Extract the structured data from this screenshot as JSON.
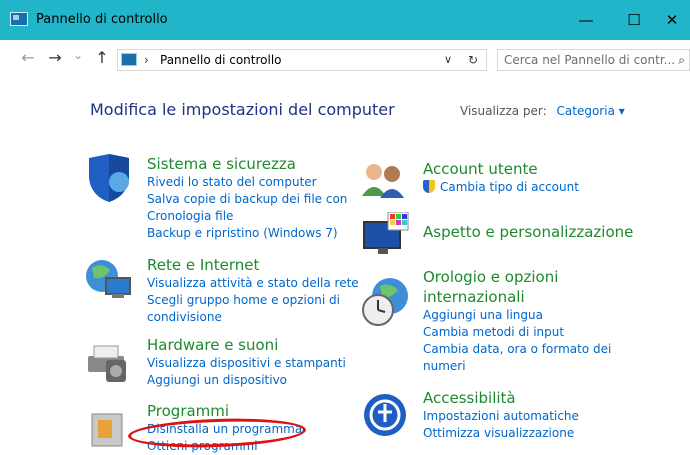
{
  "window": {
    "title": "Pannello di controllo",
    "min": "—",
    "max": "☐",
    "close": "✕"
  },
  "nav": {
    "back": "←",
    "forward": "→",
    "recent": "⌄",
    "up": "↑"
  },
  "address": {
    "separator": "›",
    "path": "Pannello di controllo",
    "dropdown": "∨",
    "refresh": "↻"
  },
  "search": {
    "placeholder": "Cerca nel Pannello di contr..."
  },
  "main": {
    "heading": "Modifica le impostazioni del computer",
    "view_by_label": "Visualizza per:",
    "view_by_value": "Categoria ▾"
  },
  "categories": {
    "sistema": {
      "title": "Sistema e sicurezza",
      "links": [
        "Rivedi lo stato del computer",
        "Salva copie di backup dei file con",
        "Cronologia file",
        "Backup e ripristino (Windows 7)"
      ]
    },
    "rete": {
      "title": "Rete e Internet",
      "links": [
        "Visualizza attività e stato della rete",
        "Scegli gruppo home e opzioni di",
        "condivisione"
      ]
    },
    "hardware": {
      "title": "Hardware e suoni",
      "links": [
        "Visualizza dispositivi e stampanti",
        "Aggiungi un dispositivo"
      ]
    },
    "programmi": {
      "title": "Programmi",
      "links": [
        "Disinstalla un programma",
        "Ottieni programmi"
      ]
    },
    "account": {
      "title": "Account utente",
      "links": [
        "Cambia tipo di account"
      ]
    },
    "aspetto": {
      "title": "Aspetto e personalizzazione",
      "links": []
    },
    "orologio": {
      "title_line1": "Orologio e opzioni",
      "title_line2": "internazionali",
      "links": [
        "Aggiungi una lingua",
        "Cambia metodi di input",
        "Cambia data, ora o formato dei",
        "numeri"
      ]
    },
    "accessibilita": {
      "title": "Accessibilità",
      "links": [
        "Impostazioni automatiche",
        "Ottimizza visualizzazione"
      ]
    }
  }
}
